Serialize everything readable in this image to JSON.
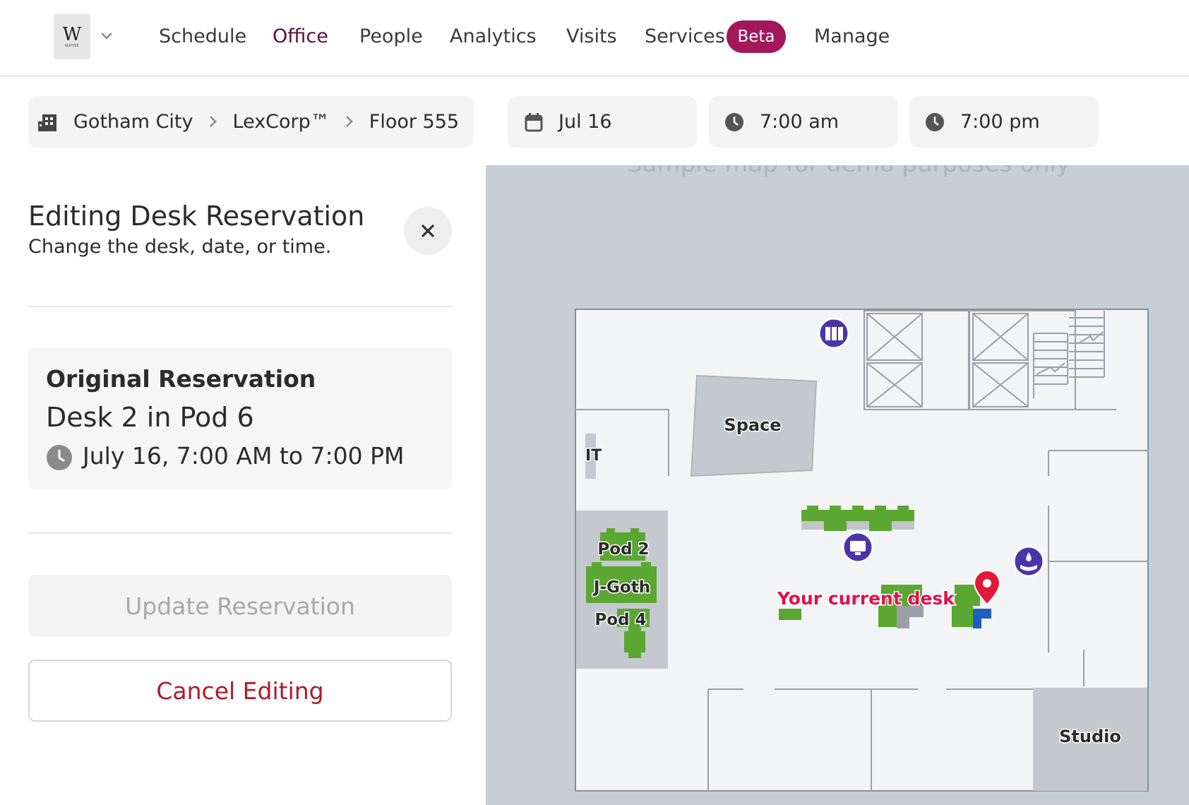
{
  "nav": {
    "logo_text": "W",
    "logo_subtext": "WAYNE",
    "items": [
      "Schedule",
      "Office",
      "People",
      "Analytics",
      "Visits",
      "Services",
      "Manage"
    ],
    "active": "Office",
    "beta_badge": "Beta"
  },
  "filters": {
    "breadcrumb": [
      "Gotham City",
      "LexCorp™",
      "Floor 555"
    ],
    "date": "Jul 16",
    "start_time": "7:00 am",
    "end_time": "7:00 pm"
  },
  "panel": {
    "title": "Editing Desk Reservation",
    "subtitle": "Change the desk, date, or time.",
    "original": {
      "heading": "Original Reservation",
      "desk": "Desk 2 in Pod 6",
      "time": "July 16, 7:00 AM to 7:00 PM"
    },
    "update_label": "Update Reservation",
    "cancel_label": "Cancel Editing"
  },
  "map": {
    "note": "Sample map for demo purposes only",
    "labels": {
      "space": "Space",
      "it": "IT",
      "pod2": "Pod 2",
      "jgoth": "J-Goth",
      "pod4": "Pod 4",
      "current_desk": "Your current desk",
      "studio": "Studio"
    },
    "colors": {
      "background": "#c8ced6",
      "floor": "#f3f4f5",
      "room": "#c5c9cf",
      "desk_green": "#5aa832",
      "desk_gray": "#c0c4c8",
      "amenity": "#4a35a8",
      "pin": "#e0193a",
      "current_label": "#e0104f"
    },
    "amenity_icons": [
      "lockers-icon",
      "monitor-icon",
      "hand-wash-icon"
    ]
  }
}
